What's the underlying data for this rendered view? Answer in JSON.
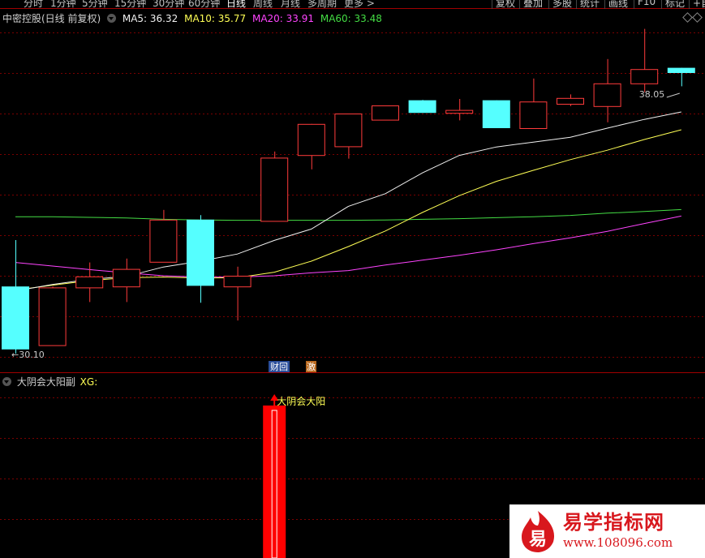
{
  "period_tabs": [
    {
      "label": "分时",
      "active": false
    },
    {
      "label": "1分钟",
      "active": false
    },
    {
      "label": "5分钟",
      "active": false
    },
    {
      "label": "15分钟",
      "active": false
    },
    {
      "label": "30分钟",
      "active": false
    },
    {
      "label": "60分钟",
      "active": false
    },
    {
      "label": "日线",
      "active": true
    },
    {
      "label": "周线",
      "active": false
    },
    {
      "label": "月线",
      "active": false
    },
    {
      "label": "多周期",
      "active": false
    },
    {
      "label": "更多 >",
      "active": false
    }
  ],
  "toolbar": {
    "fuquan": "复权",
    "overlay": "叠加",
    "multi": "多股",
    "stats": "统计",
    "draw": "画线",
    "f10": "F10",
    "mark": "标记",
    "more": "+自"
  },
  "main_legend": {
    "title": "中密控股(日线 前复权)",
    "ma5": "MA5: 36.32",
    "ma10": "MA10: 35.77",
    "ma20": "MA20: 33.91",
    "ma60": "MA60: 33.48"
  },
  "sub_legend": {
    "title": "大阴会大阳副",
    "xg": "XG:"
  },
  "annotations": {
    "high": "38.05",
    "low": "30.10",
    "caihui": "财回",
    "ji": "激",
    "signal": "大阴会大阳"
  },
  "colors": {
    "up": "#ff3b3b",
    "down": "#55ffff",
    "ma5": "#f0f0f0",
    "ma10": "#ffff55",
    "ma20": "#ff44ff",
    "ma60": "#44dd44",
    "grid": "#7a0000",
    "signal_bar": "#ff0000"
  },
  "logo": {
    "title": "易学指标网",
    "url": "www.108096.com",
    "mark": "易"
  },
  "chart_data": {
    "type": "candlestick",
    "candles": [
      {
        "o": 32.17,
        "h": 33.6,
        "l": 30.1,
        "c": 30.23
      },
      {
        "o": 30.36,
        "h": 32.17,
        "l": 30.36,
        "c": 32.14
      },
      {
        "o": 32.14,
        "h": 32.91,
        "l": 31.69,
        "c": 32.48
      },
      {
        "o": 32.17,
        "h": 33.03,
        "l": 31.69,
        "c": 32.71
      },
      {
        "o": 32.93,
        "h": 34.53,
        "l": 32.93,
        "c": 34.23
      },
      {
        "o": 34.23,
        "h": 34.37,
        "l": 31.67,
        "c": 32.19
      },
      {
        "o": 32.17,
        "h": 32.78,
        "l": 31.12,
        "c": 32.5
      },
      {
        "o": 34.19,
        "h": 36.33,
        "l": 34.19,
        "c": 36.14
      },
      {
        "o": 36.22,
        "h": 36.93,
        "l": 35.78,
        "c": 37.18
      },
      {
        "o": 36.49,
        "h": 37.5,
        "l": 36.11,
        "c": 37.5
      },
      {
        "o": 37.31,
        "h": 37.55,
        "l": 37.31,
        "c": 37.75
      },
      {
        "o": 37.91,
        "h": 37.92,
        "l": 37.52,
        "c": 37.52
      },
      {
        "o": 37.52,
        "h": 37.95,
        "l": 37.29,
        "c": 37.61
      },
      {
        "o": 37.91,
        "h": 37.91,
        "l": 37.05,
        "c": 37.05
      },
      {
        "o": 37.05,
        "h": 38.58,
        "l": 37.05,
        "c": 37.87
      },
      {
        "o": 37.8,
        "h": 38.09,
        "l": 37.73,
        "c": 37.98
      },
      {
        "o": 37.73,
        "h": 39.18,
        "l": 37.23,
        "c": 38.43
      },
      {
        "o": 38.43,
        "h": 40.11,
        "l": 38.16,
        "c": 38.87
      },
      {
        "o": 38.91,
        "h": 38.05,
        "l": 38.34,
        "c": 38.75
      }
    ],
    "ma5": [
      32.03,
      32.23,
      32.39,
      32.48,
      32.77,
      32.95,
      33.17,
      33.59,
      33.94,
      34.64,
      35.03,
      35.67,
      36.21,
      36.47,
      36.62,
      36.77,
      37.05,
      37.32,
      37.55
    ],
    "ma10": [
      32.06,
      32.21,
      32.35,
      32.44,
      32.46,
      32.43,
      32.44,
      32.61,
      32.95,
      33.4,
      33.88,
      34.45,
      34.97,
      35.41,
      35.75,
      36.08,
      36.37,
      36.7,
      37.0
    ],
    "ma20": [
      32.91,
      32.8,
      32.69,
      32.59,
      32.5,
      32.46,
      32.46,
      32.5,
      32.59,
      32.66,
      32.83,
      32.98,
      33.13,
      33.3,
      33.49,
      33.67,
      33.87,
      34.11,
      34.34
    ],
    "ma60": [
      34.32,
      34.32,
      34.3,
      34.28,
      34.24,
      34.22,
      34.21,
      34.21,
      34.21,
      34.21,
      34.22,
      34.24,
      34.26,
      34.29,
      34.32,
      34.36,
      34.43,
      34.48,
      34.54
    ],
    "signal_index": 7
  }
}
